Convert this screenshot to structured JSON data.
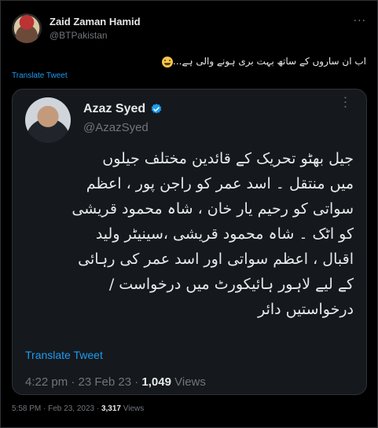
{
  "tweet": {
    "author_name": "Zaid Zaman Hamid",
    "author_handle": "@BTPakistan",
    "more_label": "···",
    "text": "اب ان ساروں کے ساتھ بہت بری ہونے والی ہے...",
    "emoji": "grinning-face-emoji",
    "translate_label": "Translate Tweet",
    "time": "5:58 PM · Feb 23, 2023 · ",
    "views_count": "3,317",
    "views_label": " Views"
  },
  "quoted": {
    "author_name": "Azaz Syed",
    "author_handle": "@AzazSyed",
    "more_label": "···",
    "verified_color": "#1d9bf0",
    "text_lines": [
      "جیل بھٹو تحریک کے قائدین مختلف جیلوں",
      "میں منتقل ۔ اسد عمر کو راجن پور ، اعظم",
      "سواتی کو رحیم یار خان ، شاہ محمود قریشی",
      "کو اٹک ۔ شاہ محمود قریشی ،سینیٹر ولید",
      "اقبال ، اعظم سواتی اور اسد عمر کی رہائی",
      "کے لیے لاہور ہائیکورٹ میں درخواست /",
      "درخواستیں دائر"
    ],
    "translate_label": "Translate Tweet",
    "time": "4:22 pm · 23 Feb 23 · ",
    "views_count": "1,049",
    "views_label": " Views"
  },
  "colors": {
    "background": "#000000",
    "card": "#15181c",
    "border": "#2f3336",
    "link": "#1d9bf0",
    "muted": "#71767b",
    "text": "#e7e9ea"
  }
}
